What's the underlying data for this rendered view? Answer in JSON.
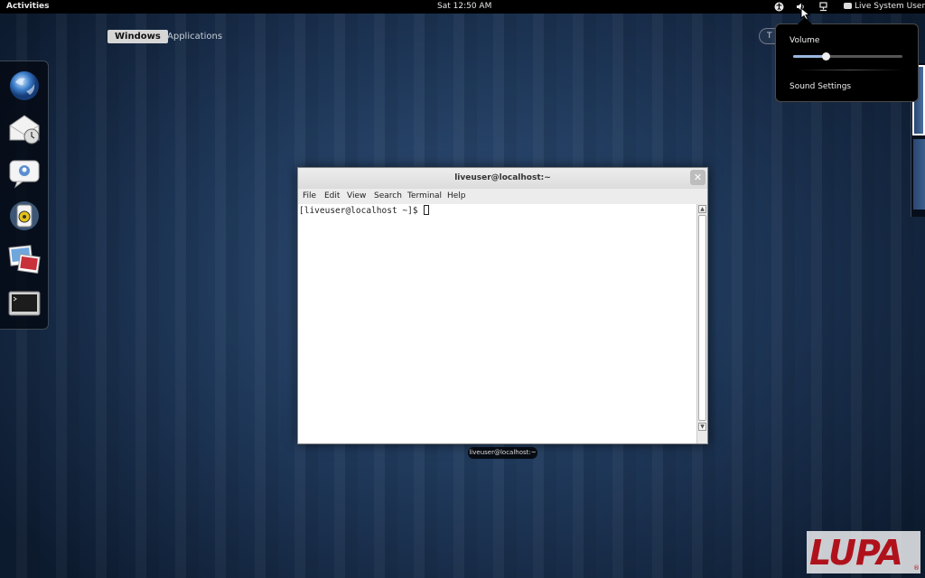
{
  "topbar": {
    "activities": "Activities",
    "clock": "Sat 12:50 AM",
    "user": "Live System User",
    "tray_icons": [
      "accessibility-icon",
      "volume-icon",
      "network-icon"
    ]
  },
  "overview": {
    "tabs": [
      {
        "label": "Windows",
        "active": true
      },
      {
        "label": "Applications",
        "active": false
      }
    ],
    "search_placeholder": "T"
  },
  "dash": {
    "apps": [
      "firefox-icon",
      "evolution-mail-icon",
      "empathy-chat-icon",
      "rhythmbox-icon",
      "shotwell-photos-icon",
      "terminal-icon"
    ]
  },
  "volume_menu": {
    "label": "Volume",
    "level": 0.3,
    "settings": "Sound Settings"
  },
  "terminal_window": {
    "title": "liveuser@localhost:~",
    "menu": [
      "File",
      "Edit",
      "View",
      "Search",
      "Terminal",
      "Help"
    ],
    "prompt": "[liveuser@localhost ~]$ ",
    "caption": "liveuser@localhost:~"
  },
  "watermark": {
    "text": "LUPA",
    "mark": "®"
  },
  "colors": {
    "topbar": "#000000",
    "desktop": "#203a5c",
    "accent_slider": "#9ab6e0",
    "logo_red": "#b0121c"
  }
}
